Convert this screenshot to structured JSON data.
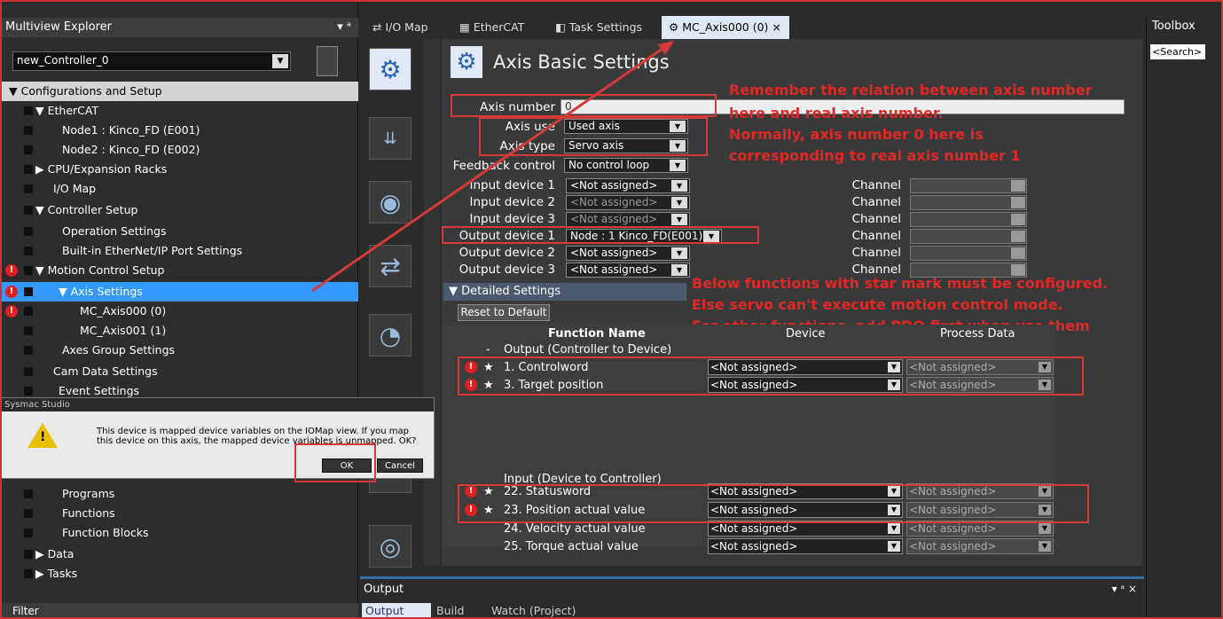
{
  "explorer": {
    "title": "Multiview Explorer",
    "pin": "▾ ᵃ",
    "controller": "new_Controller_0",
    "filter_label": "Filter",
    "tree": [
      {
        "label": "Configurations and Setup",
        "kind": "root"
      },
      {
        "label": "EtherCAT"
      },
      {
        "label": "Node1 : Kinco_FD (E001)"
      },
      {
        "label": "Node2 : Kinco_FD (E002)"
      },
      {
        "label": "CPU/Expansion Racks"
      },
      {
        "label": "I/O Map"
      },
      {
        "label": "Controller Setup"
      },
      {
        "label": "Operation Settings"
      },
      {
        "label": "Built-in EtherNet/IP Port Settings"
      },
      {
        "label": "Motion Control Setup"
      },
      {
        "label": "Axis Settings"
      },
      {
        "label": "MC_Axis000 (0)"
      },
      {
        "label": "MC_Axis001 (1)"
      },
      {
        "label": "Axes Group Settings"
      },
      {
        "label": "Cam Data Settings"
      },
      {
        "label": "Event Settings"
      },
      {
        "label": "Programs"
      },
      {
        "label": "Functions"
      },
      {
        "label": "Function Blocks"
      },
      {
        "label": "Data"
      },
      {
        "label": "Tasks"
      }
    ]
  },
  "dialog": {
    "title": "Sysmac Studio",
    "message": "This device is mapped device variables on the IOMap view. If you map this device on this axis, the mapped device variables is unmapped. OK?",
    "ok_label": "OK",
    "cancel_label": "Cancel"
  },
  "tabs": [
    {
      "label": "I/O Map"
    },
    {
      "label": "EtherCAT"
    },
    {
      "label": "Task Settings"
    },
    {
      "label": "MC_Axis000 (0)  ×"
    }
  ],
  "editor": {
    "title": "Axis Basic Settings",
    "axis_number_label": "Axis number",
    "axis_number_value": "0",
    "axis_use_label": "Axis use",
    "axis_use_value": "Used axis",
    "axis_type_label": "Axis type",
    "axis_type_value": "Servo axis",
    "feedback_label": "Feedback control",
    "feedback_value": "No control loop",
    "devices": [
      {
        "label": "Input device 1",
        "value": "<Not assigned>",
        "dim": false
      },
      {
        "label": "Input device 2",
        "value": "<Not assigned>",
        "dim": true
      },
      {
        "label": "Input device 3",
        "value": "<Not assigned>",
        "dim": true
      },
      {
        "label": "Output device 1",
        "value": "Node : 1 Kinco_FD(E001)",
        "dim": false
      },
      {
        "label": "Output device 2",
        "value": "<Not assigned>",
        "dim": false
      },
      {
        "label": "Output device 3",
        "value": "<Not assigned>",
        "dim": false
      }
    ],
    "channel_label": "Channel",
    "detailed_label": "Detailed Settings",
    "reset_label": "Reset to Default",
    "col_function": "Function Name",
    "col_device": "Device",
    "col_process": "Process Data",
    "group_output": "Output (Controller to Device)",
    "group_input": "Input (Device to Controller)",
    "rows_out": [
      {
        "name": "1. Controlword",
        "device": "<Not assigned>",
        "pd": "<Not assigned>",
        "req": true
      },
      {
        "name": "3. Target position",
        "device": "<Not assigned>",
        "pd": "<Not assigned>",
        "req": true
      }
    ],
    "rows_in": [
      {
        "name": "22. Statusword",
        "device": "<Not assigned>",
        "pd": "<Not assigned>",
        "req": true
      },
      {
        "name": "23. Position actual value",
        "device": "<Not assigned>",
        "pd": "<Not assigned>",
        "req": true
      },
      {
        "name": "24. Velocity actual value",
        "device": "<Not assigned>",
        "pd": "<Not assigned>",
        "req": false
      },
      {
        "name": "25. Torque actual value",
        "device": "<Not assigned>",
        "pd": "<Not assigned>",
        "req": false
      }
    ]
  },
  "annotations": {
    "note1": [
      "Remember the relation between axis number",
      "here and real axis number.",
      "Normally, axis number 0 here is",
      "corresponding to real axis number 1"
    ],
    "note2": [
      "Below  functions with star mark must be configured.",
      "Else servo can't execute motion control mode.",
      "For other functions, add PDO first when use them"
    ]
  },
  "toolbox": {
    "title": "Toolbox",
    "search": "<Search>"
  },
  "output": {
    "title": "Output",
    "controls": "▾ ᵃ ×",
    "tabs": [
      "Output",
      "Build",
      "Watch (Project)"
    ]
  },
  "colors": {
    "accent": "#3399ff",
    "annotation": "#e02828",
    "error": "#e02020"
  }
}
